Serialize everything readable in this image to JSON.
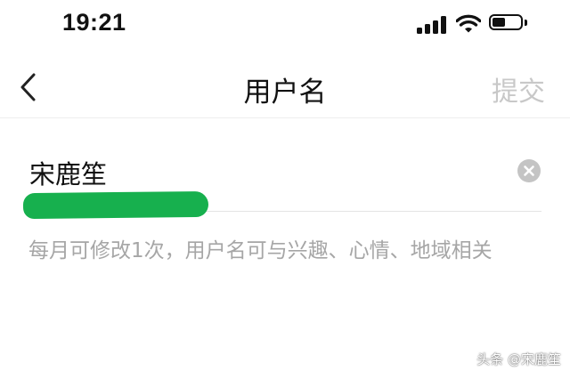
{
  "status_bar": {
    "time": "19:21",
    "signal_icon": "cellular-signal-icon",
    "wifi_icon": "wifi-icon",
    "battery_icon": "battery-icon",
    "battery_level": 0.45
  },
  "nav": {
    "back_icon": "chevron-left-icon",
    "title": "用户名",
    "submit_label": "提交"
  },
  "username_field": {
    "value": "宋鹿笙",
    "clear_icon": "clear-circle-icon"
  },
  "hint": "每月可修改1次，用户名可与兴趣、心情、地域相关",
  "watermark": "头条 @宋鹿笙",
  "colors": {
    "background": "#ffffff",
    "text_primary": "#111111",
    "text_secondary": "#a6a6a6",
    "submit_disabled": "#c8c8c8",
    "divider": "#e4e4e4",
    "redaction_marker": "#17b04e"
  }
}
